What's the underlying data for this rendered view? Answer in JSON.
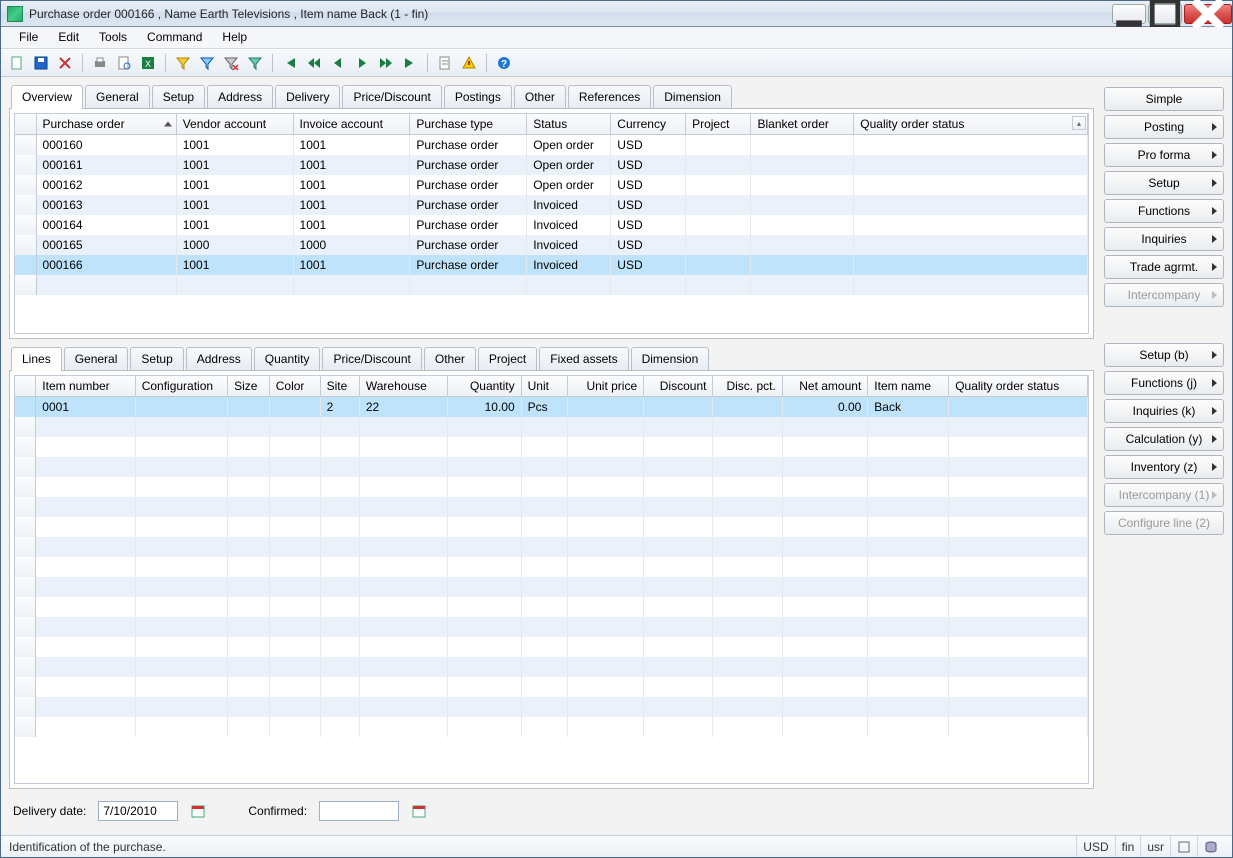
{
  "window": {
    "title": "Purchase order 000166 , Name Earth Televisions , Item name Back (1 - fin)"
  },
  "menu": [
    "File",
    "Edit",
    "Tools",
    "Command",
    "Help"
  ],
  "side_buttons_top": [
    {
      "label": "Simple",
      "arrow": false,
      "disabled": false,
      "name": "simple"
    },
    {
      "label": "Posting",
      "arrow": true,
      "disabled": false,
      "name": "posting"
    },
    {
      "label": "Pro forma",
      "arrow": true,
      "disabled": false,
      "name": "pro-forma"
    },
    {
      "label": "Setup",
      "arrow": true,
      "disabled": false,
      "name": "setup"
    },
    {
      "label": "Functions",
      "arrow": true,
      "disabled": false,
      "name": "functions"
    },
    {
      "label": "Inquiries",
      "arrow": true,
      "disabled": false,
      "name": "inquiries"
    },
    {
      "label": "Trade agrmt.",
      "arrow": true,
      "disabled": false,
      "name": "trade-agrmt"
    },
    {
      "label": "Intercompany",
      "arrow": true,
      "disabled": true,
      "name": "intercompany"
    }
  ],
  "side_buttons_bottom": [
    {
      "label": "Setup (b)",
      "arrow": true,
      "disabled": false,
      "name": "setup-b"
    },
    {
      "label": "Functions (j)",
      "arrow": true,
      "disabled": false,
      "name": "functions-j"
    },
    {
      "label": "Inquiries (k)",
      "arrow": true,
      "disabled": false,
      "name": "inquiries-k"
    },
    {
      "label": "Calculation (y)",
      "arrow": true,
      "disabled": false,
      "name": "calculation-y"
    },
    {
      "label": "Inventory (z)",
      "arrow": true,
      "disabled": false,
      "name": "inventory-z"
    },
    {
      "label": "Intercompany (1)",
      "arrow": true,
      "disabled": true,
      "name": "intercompany-1"
    },
    {
      "label": "Configure line (2)",
      "arrow": false,
      "disabled": true,
      "name": "configure-line-2"
    }
  ],
  "top_tabs": [
    "Overview",
    "General",
    "Setup",
    "Address",
    "Delivery",
    "Price/Discount",
    "Postings",
    "Other",
    "References",
    "Dimension"
  ],
  "bottom_tabs": [
    "Lines",
    "General",
    "Setup",
    "Address",
    "Quantity",
    "Price/Discount",
    "Other",
    "Project",
    "Fixed assets",
    "Dimension"
  ],
  "orders": {
    "columns": [
      "Purchase order",
      "Vendor account",
      "Invoice account",
      "Purchase type",
      "Status",
      "Currency",
      "Project",
      "Blanket order",
      "Quality order status"
    ],
    "sorted_column": 0,
    "rows": [
      {
        "po": "000160",
        "vendor": "1001",
        "invoice": "1001",
        "type": "Purchase order",
        "status": "Open order",
        "currency": "USD",
        "project": "",
        "blanket": "",
        "quality": ""
      },
      {
        "po": "000161",
        "vendor": "1001",
        "invoice": "1001",
        "type": "Purchase order",
        "status": "Open order",
        "currency": "USD",
        "project": "",
        "blanket": "",
        "quality": ""
      },
      {
        "po": "000162",
        "vendor": "1001",
        "invoice": "1001",
        "type": "Purchase order",
        "status": "Open order",
        "currency": "USD",
        "project": "",
        "blanket": "",
        "quality": ""
      },
      {
        "po": "000163",
        "vendor": "1001",
        "invoice": "1001",
        "type": "Purchase order",
        "status": "Invoiced",
        "currency": "USD",
        "project": "",
        "blanket": "",
        "quality": ""
      },
      {
        "po": "000164",
        "vendor": "1001",
        "invoice": "1001",
        "type": "Purchase order",
        "status": "Invoiced",
        "currency": "USD",
        "project": "",
        "blanket": "",
        "quality": ""
      },
      {
        "po": "000165",
        "vendor": "1000",
        "invoice": "1000",
        "type": "Purchase order",
        "status": "Invoiced",
        "currency": "USD",
        "project": "",
        "blanket": "",
        "quality": ""
      },
      {
        "po": "000166",
        "vendor": "1001",
        "invoice": "1001",
        "type": "Purchase order",
        "status": "Invoiced",
        "currency": "USD",
        "project": "",
        "blanket": "",
        "quality": "",
        "selected": true
      }
    ]
  },
  "lines": {
    "columns": [
      "Item number",
      "Configuration",
      "Size",
      "Color",
      "Site",
      "Warehouse",
      "Quantity",
      "Unit",
      "Unit price",
      "Discount",
      "Disc. pct.",
      "Net amount",
      "Item name",
      "Quality order status"
    ],
    "rows": [
      {
        "item": "0001",
        "config": "",
        "size": "",
        "color": "",
        "site": "2",
        "warehouse": "22",
        "qty": "10.00",
        "unit": "Pcs",
        "unitprice": "",
        "discount": "",
        "discpct": "",
        "net": "0.00",
        "itemname": "Back",
        "quality": "",
        "selected": true
      }
    ],
    "blank_rows": 16
  },
  "footer": {
    "delivery_date_label": "Delivery date:",
    "delivery_date": "7/10/2010",
    "confirmed_label": "Confirmed:",
    "confirmed": ""
  },
  "statusbar": {
    "help": "Identification of the purchase.",
    "currency": "USD",
    "company": "fin",
    "user": "usr"
  }
}
